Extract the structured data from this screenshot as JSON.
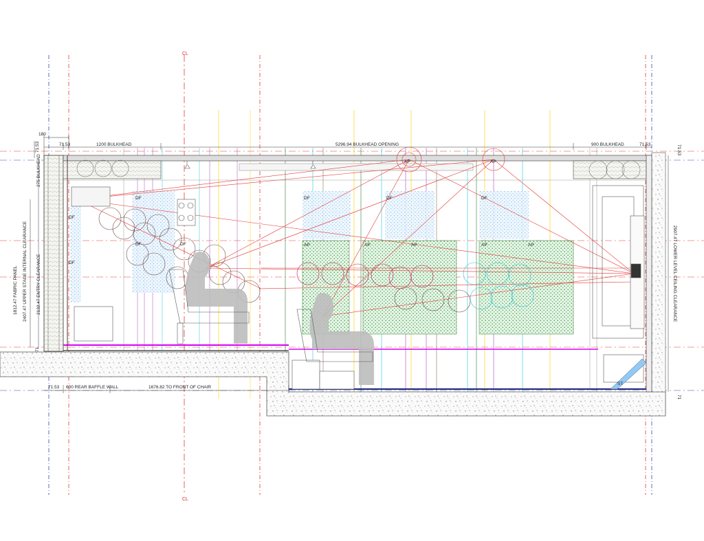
{
  "drawing": {
    "centerline_label": "CL",
    "dimensions": {
      "top_left_offset": "180",
      "left_small_a": "71.53",
      "bulkhead_left": "1200 BULKHEAD",
      "bulkhead_opening": "5296.94 BULKHEAD OPENING",
      "bulkhead_right": "900 BULKHEAD",
      "right_small_a": "71.53",
      "top_left_small": "71.53",
      "left_275": "275 BULKHEAD",
      "left_fabric": "1812.47 FABRIC PANEL",
      "left_upper_stage": "2407.47 UPPER STAGE INTERNAL CLEARANCE",
      "left_entry": "2132.47 ENTRY CLEARANCE",
      "left_71": "71",
      "bottom_left_small": "71.53",
      "rear_baffle": "600 REAR BAFFLE WALL",
      "to_chair": "1676.82 TO FRONT OF CHAIR",
      "right_side_small": "71.53",
      "right_lower_level": "2907.47 LOWER LEVEL CEILING CLEARANCE",
      "right_bottom_71": "71"
    },
    "panel_labels": {
      "df": "DF",
      "ap": "AP",
      "st": "ST"
    }
  }
}
